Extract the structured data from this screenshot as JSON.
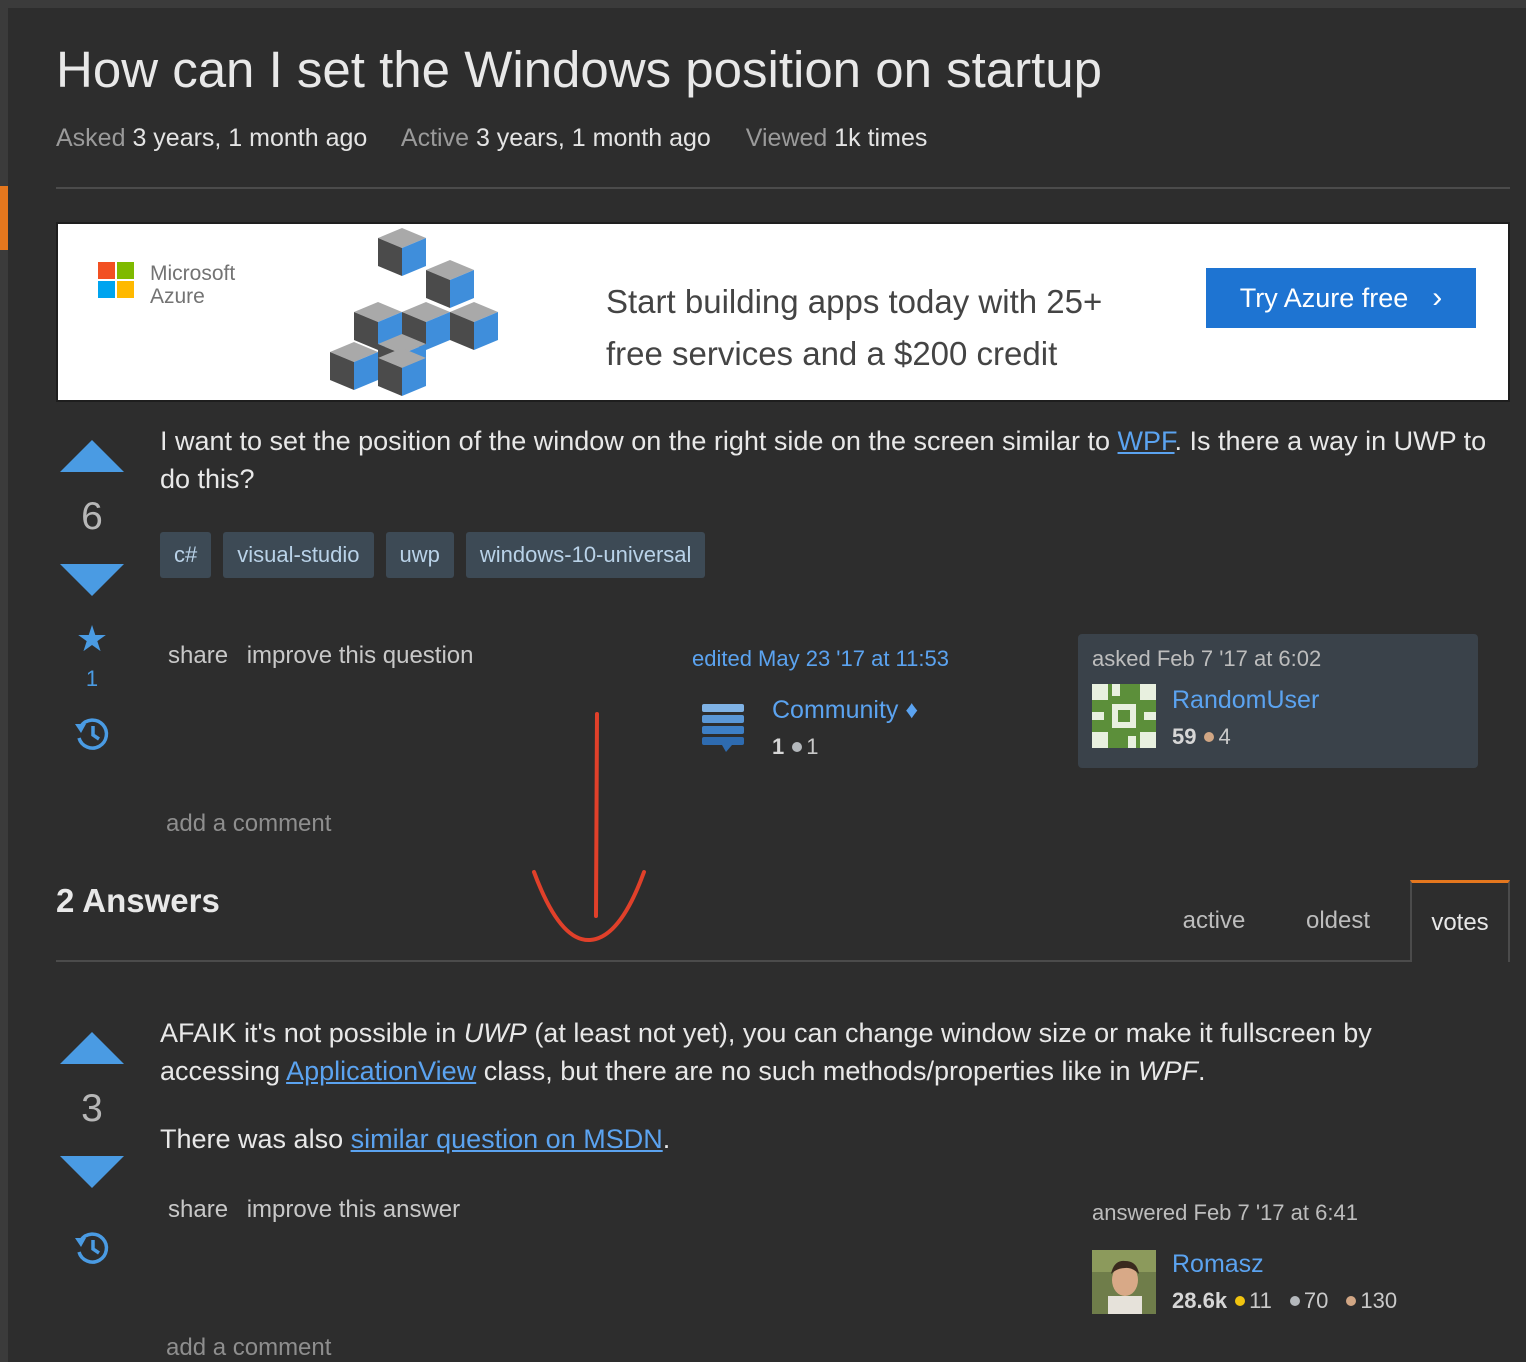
{
  "question": {
    "title": "How can I set the Windows position on startup",
    "meta": {
      "asked_label": "Asked",
      "asked_value": "3 years, 1 month ago",
      "active_label": "Active",
      "active_value": "3 years, 1 month ago",
      "viewed_label": "Viewed",
      "viewed_value": "1k times"
    },
    "body_text_1": "I want to set the position of the window on the right side on the screen similar to ",
    "body_link": "WPF",
    "body_text_2": ". Is there a way in UWP to do this?",
    "votes": "6",
    "favorites": "1",
    "tags": [
      "c#",
      "visual-studio",
      "uwp",
      "windows-10-universal"
    ],
    "share_label": "share",
    "improve_label": "improve this question",
    "add_comment": "add a comment",
    "edited": {
      "when": "edited May 23 '17 at 11:53",
      "user": "Community ♦",
      "rep": "1",
      "badge_count": "1"
    },
    "asked": {
      "when": "asked Feb 7 '17 at 6:02",
      "user": "RandomUser",
      "rep": "59",
      "badge_count": "4"
    }
  },
  "ad": {
    "brand_line1": "Microsoft",
    "brand_line2": "Azure",
    "headline_line1": "Start building apps today with 25+",
    "headline_line2": "free services and a $200 credit",
    "cta": "Try Azure free",
    "cta_icon": "chevron-right-icon",
    "logo_colors": [
      "#f25022",
      "#7fba00",
      "#00a4ef",
      "#ffb900"
    ]
  },
  "answers": {
    "heading": "2 Answers",
    "sort_tabs": [
      "active",
      "oldest",
      "votes"
    ],
    "selected_sort": "votes"
  },
  "answer1": {
    "votes": "3",
    "p1_a": "AFAIK it's not possible in ",
    "p1_b": "UWP",
    "p1_c": " (at least not yet), you can change window size or make it fullscreen by accessing ",
    "p1_link": "ApplicationView",
    "p1_d": " class, but there are no such methods/properties like in ",
    "p1_e": "WPF",
    "p1_f": ".",
    "p2_a": "There was also ",
    "p2_link": "similar question on MSDN",
    "p2_b": ".",
    "share_label": "share",
    "improve_label": "improve this answer",
    "add_comment": "add a comment",
    "answered": {
      "when": "answered Feb 7 '17 at 6:41",
      "user": "Romasz",
      "rep": "28.6k",
      "gold": "11",
      "silver": "70",
      "bronze": "130"
    }
  },
  "colors": {
    "accent": "#e5771e",
    "link": "#5ba3f0",
    "vote": "#4a9be3",
    "gold": "#f1c40f",
    "silver": "#b4b8bc",
    "bronze": "#d1a684",
    "annotation": "#e0402a"
  }
}
